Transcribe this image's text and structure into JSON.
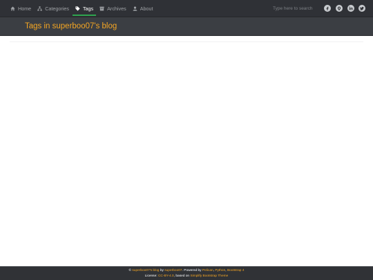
{
  "navbar": {
    "items": [
      {
        "label": "Home",
        "icon": "home-icon"
      },
      {
        "label": "Categories",
        "icon": "sitemap-icon"
      },
      {
        "label": "Tags",
        "icon": "tag-icon",
        "active": true
      },
      {
        "label": "Archives",
        "icon": "archive-icon"
      },
      {
        "label": "About",
        "icon": "user-icon"
      }
    ],
    "search_placeholder": "Type here to search",
    "social": [
      "facebook-icon",
      "github-icon",
      "linkedin-icon",
      "twitter-icon"
    ]
  },
  "header": {
    "title": "Tags in superboo07's blog"
  },
  "footer": {
    "copyright_symbol": "©",
    "blog_link": "superboo07's blog",
    "by_text": "by",
    "author_link": "superboo07",
    "powered_text": ". Powered by",
    "pelican_link": "Pelican",
    "python_link": "Python",
    "bootstrap_link": "Bootstrap 4",
    "license_text": "License:",
    "license_link": "CC-BY-4.0",
    "based_text": ", based on",
    "theme_link": "Simplify Bootstrap Theme"
  },
  "colors": {
    "navbar_bg": "#2f3136",
    "header_bg": "#3b3e43",
    "accent": "#f5a623",
    "active_underline": "#2ea44f",
    "footer_bg": "#303236"
  }
}
